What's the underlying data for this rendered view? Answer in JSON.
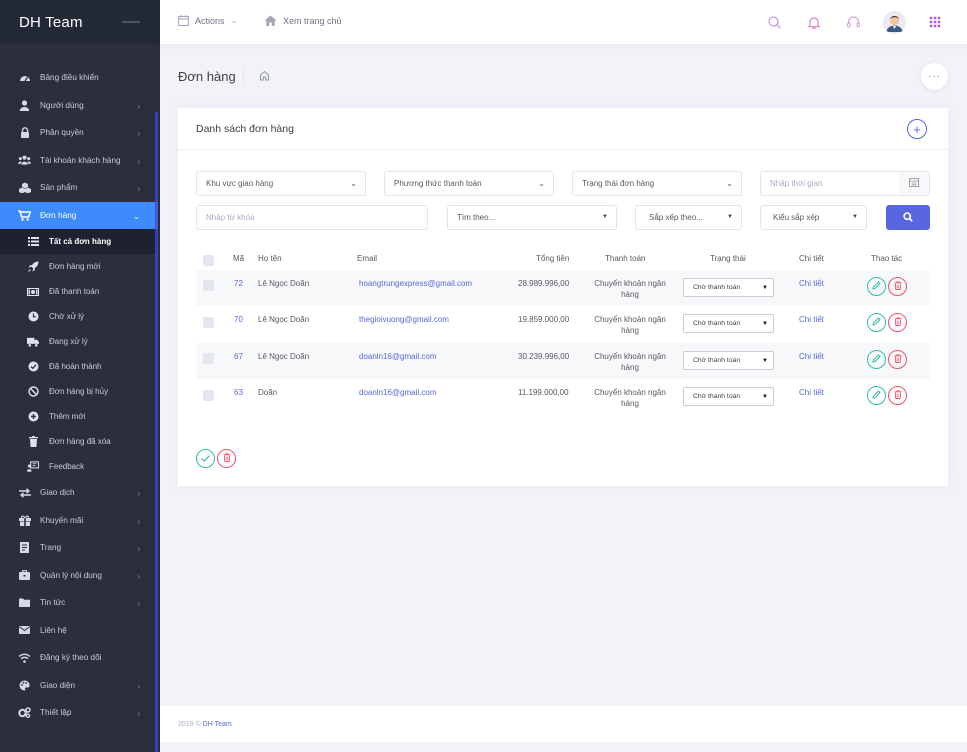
{
  "app": {
    "brand": "DH Team"
  },
  "topbar": {
    "actions_label": "Actions",
    "home_label": "Xem trang chủ"
  },
  "sidebar": {
    "items": [
      {
        "label": "Bảng điều khiển",
        "icon": "dashboard-icon",
        "arrow": false
      },
      {
        "label": "Người dùng",
        "icon": "user-icon",
        "arrow": true
      },
      {
        "label": "Phân quyền",
        "icon": "lock-icon",
        "arrow": true
      },
      {
        "label": "Tài khoản khách hàng",
        "icon": "users-icon",
        "arrow": true
      },
      {
        "label": "Sản phẩm",
        "icon": "cubes-icon",
        "arrow": true
      },
      {
        "label": "Đơn hàng",
        "icon": "cart-icon",
        "arrow": true,
        "active": true
      }
    ],
    "sub_items": [
      {
        "label": "Tất cả đơn hàng",
        "icon": "list-icon",
        "current": true
      },
      {
        "label": "Đơn hàng mới",
        "icon": "rocket-icon"
      },
      {
        "label": "Đã thanh toán",
        "icon": "money-icon"
      },
      {
        "label": "Chờ xử lý",
        "icon": "clock-icon"
      },
      {
        "label": "Đang xử lý",
        "icon": "truck-icon"
      },
      {
        "label": "Đã hoàn thành",
        "icon": "check-circle-icon"
      },
      {
        "label": "Đơn hàng bị hủy",
        "icon": "ban-icon"
      },
      {
        "label": "Thêm mới",
        "icon": "plus-circle-icon"
      },
      {
        "label": "Đơn hàng đã xóa",
        "icon": "trash-icon"
      },
      {
        "label": "Feedback",
        "icon": "feedback-icon"
      }
    ],
    "items_after": [
      {
        "label": "Giao dịch",
        "icon": "exchange-icon",
        "arrow": true
      },
      {
        "label": "Khuyến mãi",
        "icon": "gift-icon",
        "arrow": true
      },
      {
        "label": "Trang",
        "icon": "page-icon",
        "arrow": true
      },
      {
        "label": "Quản lý nội dung",
        "icon": "briefcase-icon",
        "arrow": true
      },
      {
        "label": "Tin tức",
        "icon": "folder-icon",
        "arrow": true
      },
      {
        "label": "Liên hệ",
        "icon": "envelope-icon",
        "arrow": false
      },
      {
        "label": "Đăng ký theo dõi",
        "icon": "wifi-icon",
        "arrow": false
      },
      {
        "label": "Giao diện",
        "icon": "palette-icon",
        "arrow": true
      },
      {
        "label": "Thiết lập",
        "icon": "cogs-icon",
        "arrow": true
      }
    ]
  },
  "page": {
    "title": "Đơn hàng"
  },
  "portlet": {
    "title": "Danh sách đơn hàng"
  },
  "filters": {
    "region": "Khu vực giao hàng",
    "payment_method": "Phương thức thanh toán",
    "order_status": "Trạng thái đơn hàng",
    "date_placeholder": "Nhập thời gian",
    "keyword_placeholder": "Nhập từ khóa",
    "search_by": "Tìm theo...",
    "sort_by": "Sắp xếp theo...",
    "sort_type": "Kiểu sắp xếp"
  },
  "table": {
    "headers": {
      "id": "Mã",
      "name": "Họ tên",
      "email": "Email",
      "total": "Tổng tiền",
      "payment": "Thanh toán",
      "status": "Trạng thái",
      "detail": "Chi tiết",
      "actions": "Thao tác"
    },
    "rows": [
      {
        "id": "72",
        "name": "Lê Ngọc Doãn",
        "email": "hoangtrungexpress@gmail.com",
        "total": "28.989.996,00",
        "payment_line1": "Chuyển khoản ngân",
        "payment_line2": "hàng",
        "status": "Chờ thanh toán",
        "detail": "Chi tiết"
      },
      {
        "id": "70",
        "name": "Lê Ngọc Doãn",
        "email": "thegioivuong@gmail.com",
        "total": "19.859.000,00",
        "payment_line1": "Chuyển khoản ngân",
        "payment_line2": "hàng",
        "status": "Chờ thanh toán",
        "detail": "Chi tiết"
      },
      {
        "id": "67",
        "name": "Lê Ngọc Doãn",
        "email": "doanln16@gmail.com",
        "total": "30.239.996,00",
        "payment_line1": "Chuyển khoản ngân",
        "payment_line2": "hàng",
        "status": "Chờ thanh toán",
        "detail": "Chi tiết"
      },
      {
        "id": "63",
        "name": "Doãn",
        "email": "doanln16@gmail.com",
        "total": "11.199.000,00",
        "payment_line1": "Chuyển khoản ngân",
        "payment_line2": "hàng",
        "status": "Chờ thanh toán",
        "detail": "Chi tiết"
      }
    ]
  },
  "footer": {
    "year": "2019 ©",
    "brand": "DH Team"
  },
  "colors": {
    "accent": "#5867dd",
    "active": "#3d8bfd",
    "success": "#34bfa3",
    "danger": "#f4516c",
    "sidebar": "#2c2e3e"
  }
}
